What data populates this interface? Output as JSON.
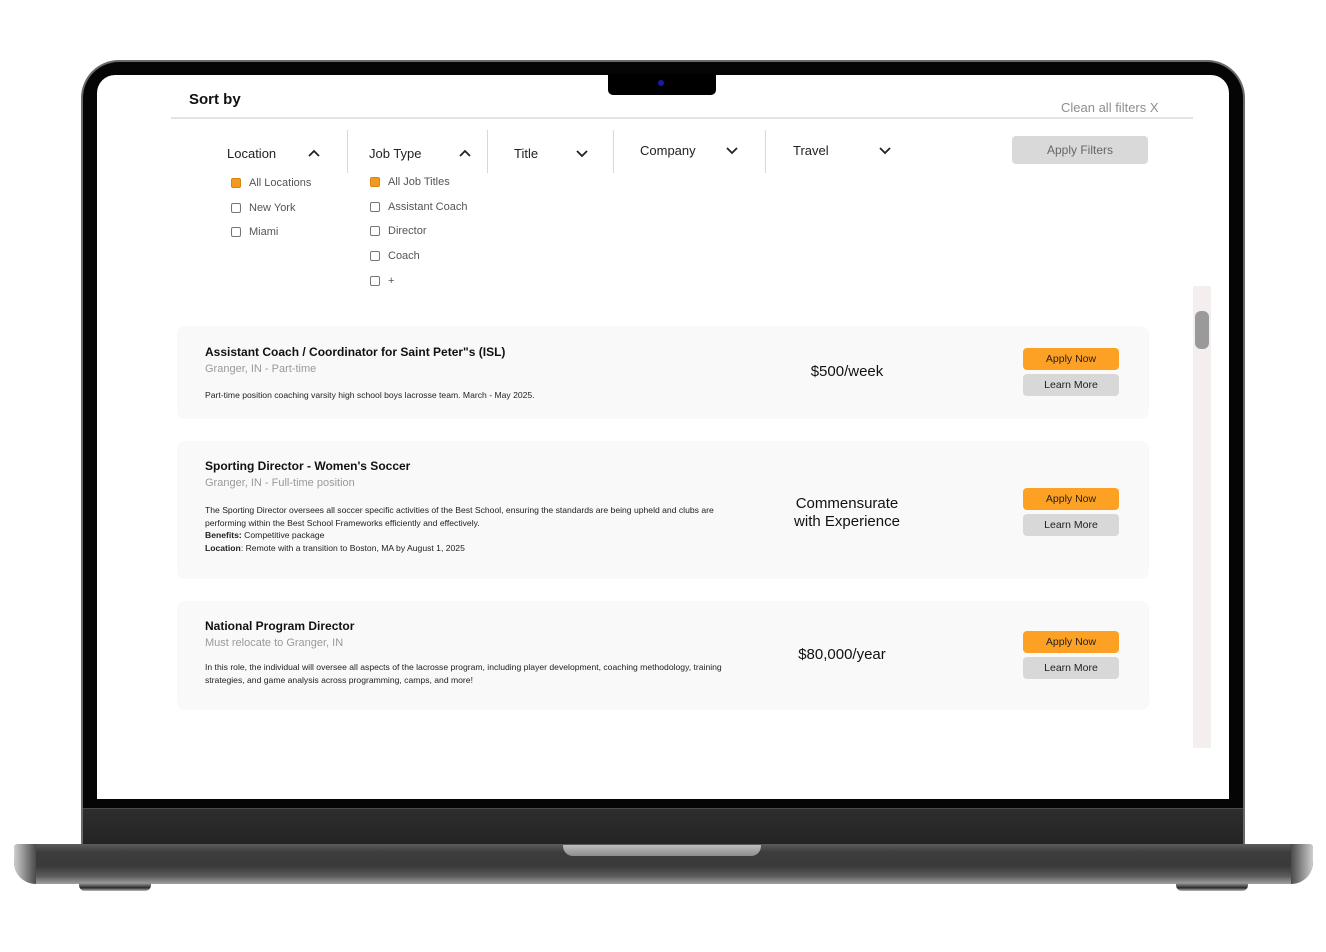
{
  "header": {
    "sort_by_label": "Sort by",
    "clean_filters_label": "Clean all filters X"
  },
  "filters": {
    "location": {
      "label": "Location",
      "expanded": true,
      "options": [
        {
          "label": "All Locations",
          "checked": true
        },
        {
          "label": "New York",
          "checked": false
        },
        {
          "label": "Miami",
          "checked": false
        }
      ]
    },
    "job_type": {
      "label": "Job Type",
      "expanded": true,
      "options": [
        {
          "label": "All Job Titles",
          "checked": true
        },
        {
          "label": "Assistant Coach",
          "checked": false
        },
        {
          "label": "Director",
          "checked": false
        },
        {
          "label": "Coach",
          "checked": false
        },
        {
          "label": "+",
          "checked": false
        }
      ]
    },
    "title": {
      "label": "Title",
      "expanded": false
    },
    "company": {
      "label": "Company",
      "expanded": false
    },
    "travel": {
      "label": "Travel",
      "expanded": false
    },
    "apply_label": "Apply Filters"
  },
  "jobs": [
    {
      "title": "Assistant Coach / Coordinator for Saint Peter\"s (ISL)",
      "subtitle": "Granger, IN - Part-time",
      "description": "Part-time position coaching varsity high school boys lacrosse team.  March - May 2025.",
      "salary_line1": "$500/week",
      "apply_label": "Apply Now",
      "learn_label": "Learn More"
    },
    {
      "title": "Sporting Director - Women's Soccer",
      "subtitle": "Granger, IN - Full-time position",
      "description": "The Sporting Director oversees all soccer specific activities of the Best School, ensuring the standards are being upheld and clubs are performing within the Best School Frameworks efficiently and effectively.",
      "benefits_label": "Benefits:",
      "benefits_value": " Competitive package",
      "location_label": "Location",
      "location_value": ": Remote with a transition to Boston, MA by August 1, 2025",
      "salary_line1": "Commensurate",
      "salary_line2": "with Experience",
      "apply_label": "Apply Now",
      "learn_label": "Learn More"
    },
    {
      "title": "National Program Director",
      "subtitle": "Must relocate to Granger, IN",
      "description": "In this role, the individual will oversee all aspects of the lacrosse program, including player development, coaching methodology, training strategies, and game analysis across programming, camps, and more!",
      "salary_line1": "$80,000/year",
      "apply_label": "Apply Now",
      "learn_label": "Learn More"
    }
  ],
  "colors": {
    "accent": "#fda125",
    "checkbox_checked": "#f39a1e",
    "secondary_button": "#d8d8d8",
    "card_background": "#f9f9f9"
  }
}
